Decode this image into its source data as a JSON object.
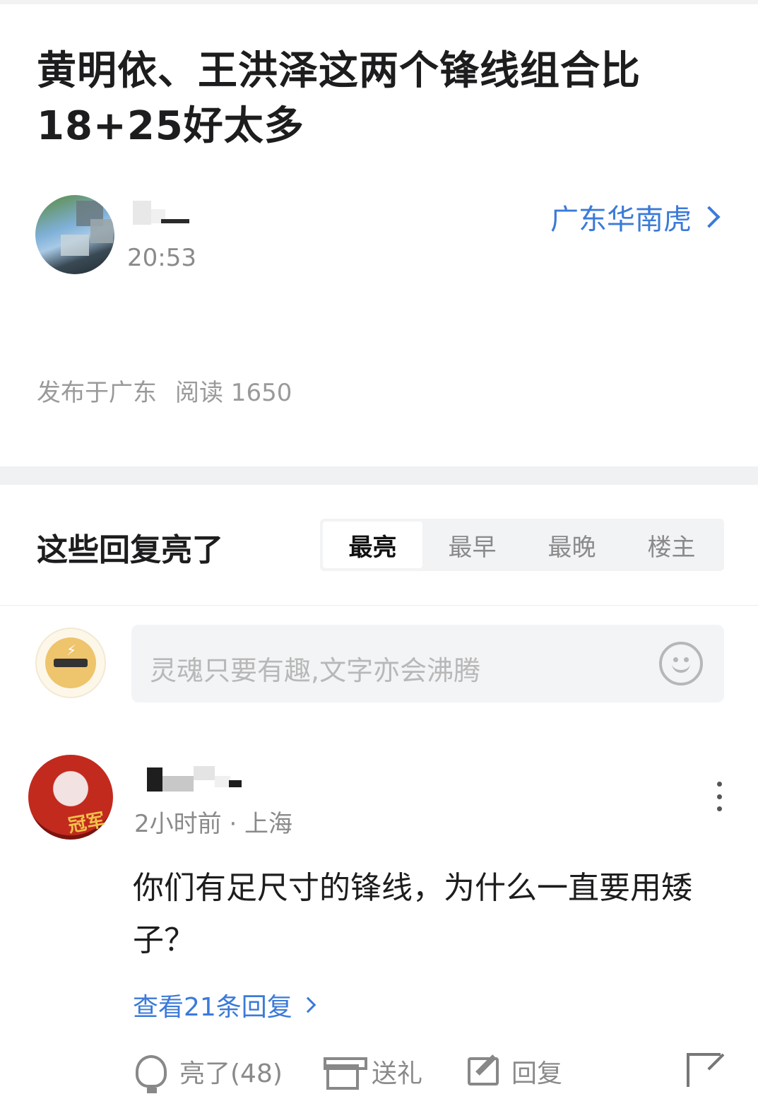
{
  "post": {
    "title": "黄明依、王洪泽这两个锋线组合比18+25好太多",
    "author_time": "20:53",
    "forum_link": "广东华南虎",
    "location_meta": "发布于广东",
    "read_meta": "阅读 1650"
  },
  "replies_section": {
    "title": "这些回复亮了",
    "sort_tabs": [
      "最亮",
      "最早",
      "最晚",
      "楼主"
    ],
    "active_tab": "最亮"
  },
  "composer": {
    "placeholder": "灵魂只要有趣,文字亦会沸腾"
  },
  "comment": {
    "meta": "2小时前 · 上海",
    "body": "你们有足尺寸的锋线，为什么一直要用矮子？",
    "view_replies": "查看21条回复",
    "avatar_text": "冠军",
    "actions": {
      "light": "亮了(48)",
      "gift": "送礼",
      "reply": "回复"
    }
  },
  "colors": {
    "accent_blue": "#3b7ad9",
    "muted_gray": "#8a8a8a",
    "divider": "#f0f1f3"
  },
  "icons": [
    "chevron-right-icon",
    "smiley-icon",
    "more-vertical-icon",
    "lightbulb-icon",
    "gift-icon",
    "edit-icon",
    "share-icon"
  ]
}
